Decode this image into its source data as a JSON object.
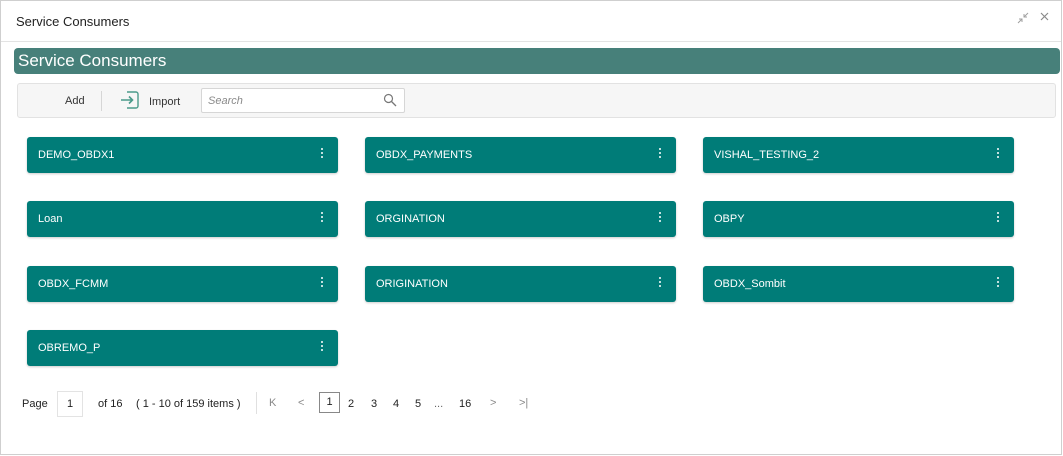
{
  "window": {
    "title": "Service Consumers",
    "minimize_icon": "compress-icon",
    "close_icon": "close-icon"
  },
  "header": {
    "title": "Service Consumers"
  },
  "toolbar": {
    "add_label": "Add",
    "import_label": "Import",
    "search_placeholder": "Search"
  },
  "colors": {
    "header_band": "#47807a",
    "card": "#007c78"
  },
  "consumers": [
    {
      "name": "DEMO_OBDX1"
    },
    {
      "name": "OBDX_PAYMENTS"
    },
    {
      "name": "VISHAL_TESTING_2"
    },
    {
      "name": "Loan"
    },
    {
      "name": "ORGINATION"
    },
    {
      "name": "OBPY"
    },
    {
      "name": "OBDX_FCMM"
    },
    {
      "name": "ORIGINATION"
    },
    {
      "name": "OBDX_Sombit"
    },
    {
      "name": "OBREMO_P"
    }
  ],
  "pagination": {
    "page_label": "Page",
    "current_page": "1",
    "of_label": "of 16",
    "items_label": "( 1 - 10 of 159 items )",
    "first_icon": "K",
    "prev_icon": "<",
    "pages": [
      "1",
      "2",
      "3",
      "4",
      "5",
      "...",
      "16"
    ],
    "next_icon": ">",
    "last_icon": ">|"
  }
}
